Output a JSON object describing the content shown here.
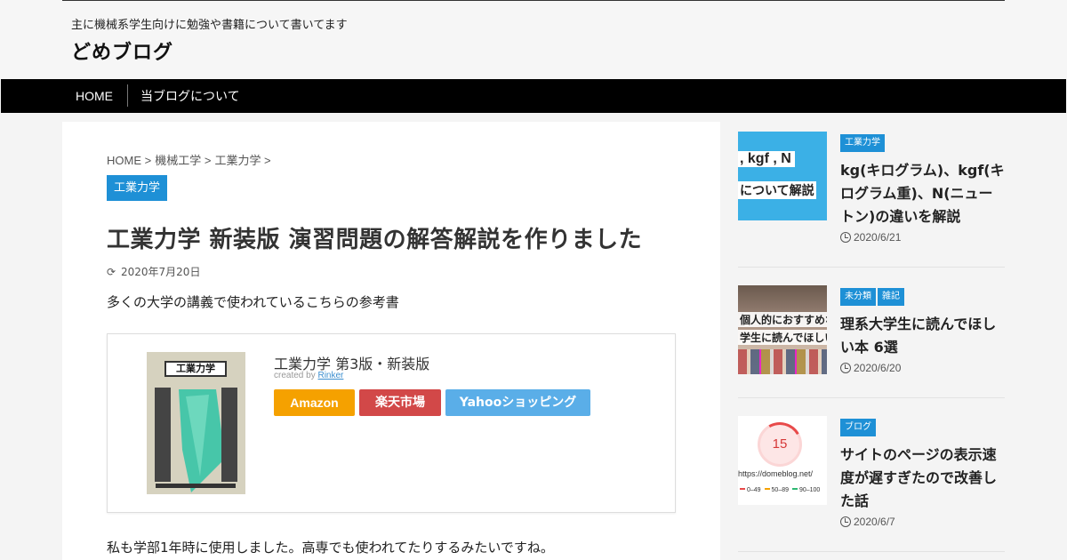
{
  "header": {
    "tagline": "主に機械系学生向けに勉強や書籍について書いてます",
    "site_title": "どめブログ"
  },
  "nav": {
    "items": [
      {
        "label": "HOME"
      },
      {
        "label": "当ブログについて"
      }
    ]
  },
  "article": {
    "breadcrumb": [
      "HOME >",
      "機械工学 >",
      "工業力学 >"
    ],
    "category": "工業力学",
    "title": "工業力学 新装版 演習問題の解答解説を作りました",
    "date": "2020年7月20日",
    "intro": "多くの大学の講義で使われているこちらの参考書",
    "body": "私も学部1年時に使用しました。高専でも使われてたりするみたいですね。"
  },
  "product": {
    "title": "工業力学 第3版・新装版",
    "credit_prefix": "created by",
    "credit_link": "Rinker",
    "book_cover_label": "工業力学",
    "buttons": {
      "amazon": "Amazon",
      "rakuten": "楽天市場",
      "yahoo": "Yahooショッピング"
    },
    "colors": {
      "amazon": "#f5a100",
      "rakuten": "#d24848",
      "yahoo": "#5aaee8"
    }
  },
  "sidebar": {
    "posts": [
      {
        "categories": [
          "工業力学"
        ],
        "title": "kg(キログラム)、kgf(キログラム重)、N(ニュートン)の違いを解説",
        "date": "2020/6/21",
        "thumb_line1": ", kgf , N",
        "thumb_line2": "について解説"
      },
      {
        "categories": [
          "未分類",
          "雑記"
        ],
        "title": "理系大学生に読んでほしい本 6選",
        "date": "2020/6/20",
        "thumb_line1": "個人的におすすめな",
        "thumb_line2": "学生に読んでほしい"
      },
      {
        "categories": [
          "ブログ"
        ],
        "title": "サイトのページの表示速度が遅すぎたので改善した話",
        "date": "2020/6/7",
        "thumb_score": "15",
        "thumb_url": "https://domeblog.net/",
        "thumb_legend": [
          "0–49",
          "50–89",
          "90–100"
        ]
      }
    ]
  },
  "accent_color": "#1e90d6"
}
